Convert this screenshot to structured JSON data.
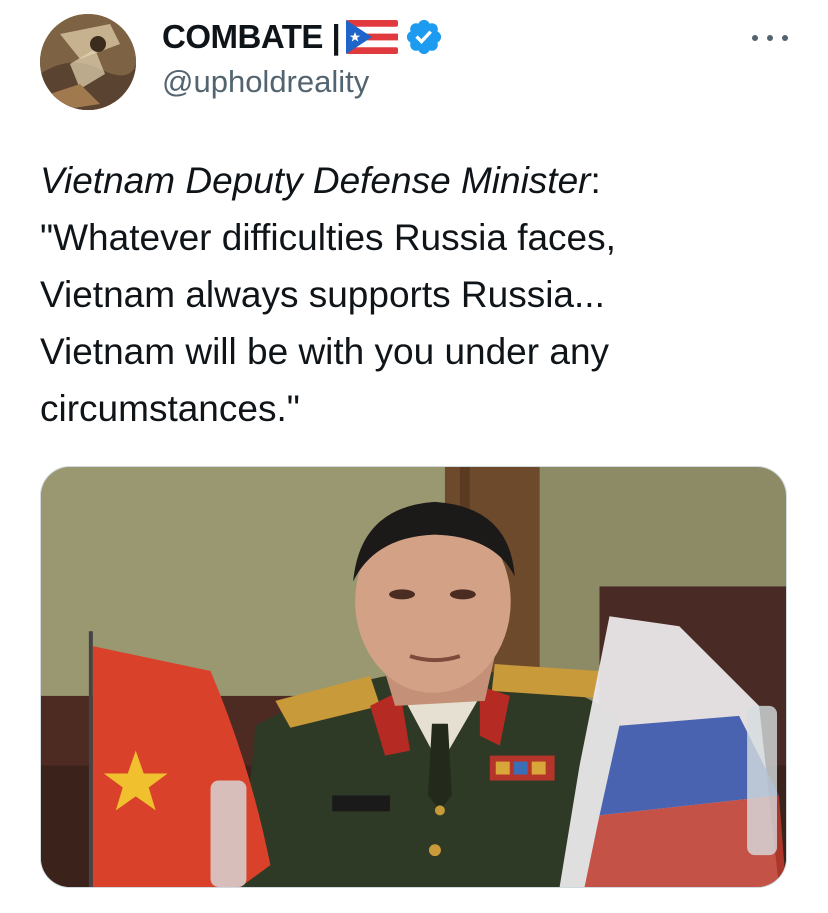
{
  "author": {
    "display_name": "COMBATE |",
    "handle": "@upholdreality",
    "verified": true,
    "avatar_icon": "avatar-photo",
    "flag_icon": "puerto-rico-flag"
  },
  "tweet": {
    "text_lines": [
      {
        "speaker": "Vietnam Deputy Defense Minister",
        "rest": ":"
      },
      "\"Whatever difficulties Russia faces,",
      "Vietnam always supports Russia...",
      "Vietnam will be with you under any",
      "circumstances.\""
    ]
  },
  "media": {
    "icons": [
      "vietnam-flag",
      "russia-flag",
      "officer-photo"
    ]
  },
  "colors": {
    "text": "#0f1419",
    "secondary": "#536471",
    "verified": "#1d9bf0",
    "border": "#cfd9de"
  },
  "more_icon": "more-dots-icon"
}
